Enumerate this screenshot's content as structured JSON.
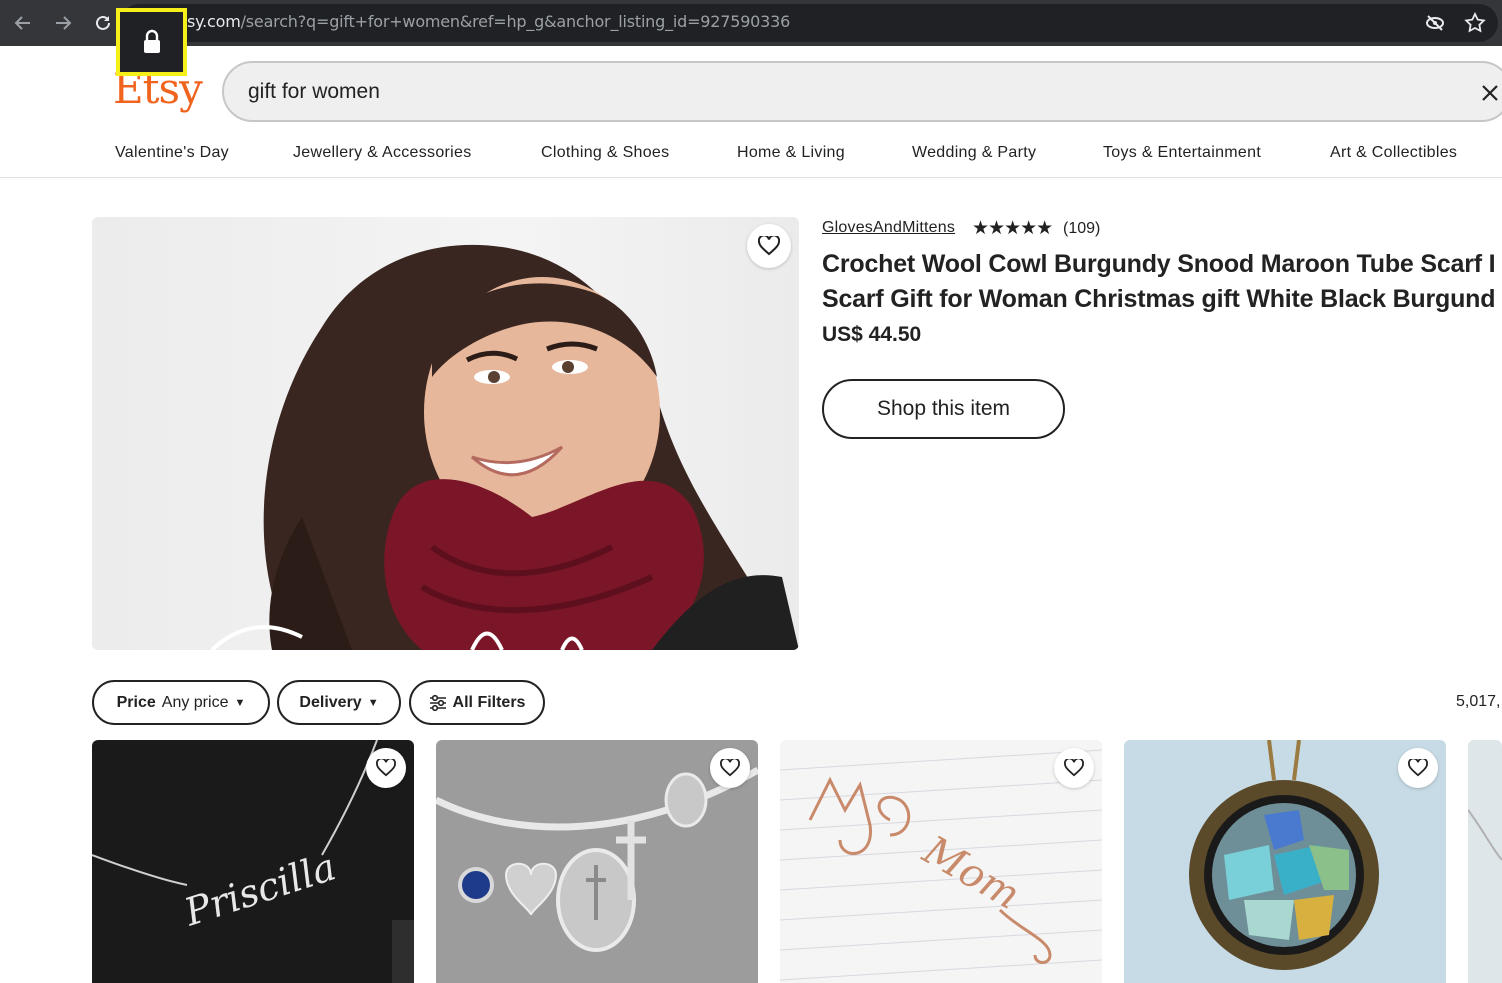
{
  "browser": {
    "url_host": "sy.com",
    "url_path": "/search?q=gift+for+women&ref=hp_g&anchor_listing_id=927590336"
  },
  "header": {
    "logo": "Etsy",
    "search_value": "gift for women"
  },
  "categories": [
    "Valentine's Day",
    "Jewellery & Accessories",
    "Clothing & Shoes",
    "Home & Living",
    "Wedding & Party",
    "Toys & Entertainment",
    "Art & Collectibles"
  ],
  "featured": {
    "shop_name": "GlovesAndMittens",
    "stars": "★★★★★",
    "rating_count": "(109)",
    "title_line1": "Crochet Wool Cowl Burgundy Snood Maroon Tube Scarf I",
    "title_line2": "Scarf Gift for Woman Christmas gift White Black Burgund",
    "price": "US$ 44.50",
    "shop_button": "Shop this item"
  },
  "filters": {
    "price_label": "Price",
    "price_value": "Any price",
    "delivery_label": "Delivery",
    "all_filters_label": "All Filters",
    "result_count": "5,017,"
  },
  "products": [
    {
      "image_text": "Priscilla"
    },
    {
      "image_text": ""
    },
    {
      "image_text": "Mom"
    },
    {
      "image_text": ""
    }
  ],
  "colors": {
    "etsy_orange": "#f1641e",
    "browser_bar": "#35363a",
    "highlight": "#f7ef1a"
  }
}
